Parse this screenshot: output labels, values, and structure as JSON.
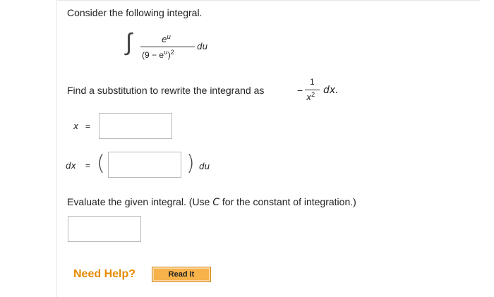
{
  "question": {
    "intro": "Consider the following integral.",
    "integral": {
      "integral_sign": "∫",
      "numerator": "e",
      "numerator_exp": "u",
      "denominator_open": "(9 − e",
      "denominator_exp": "u",
      "denominator_close": ")",
      "denominator_power": "2",
      "differential": "du"
    },
    "substitution_prompt": "Find a substitution to rewrite the integrand as",
    "target_minus": "−",
    "target_numerator": "1",
    "target_den_var": "x",
    "target_den_power": "2",
    "target_differential": "dx."
  },
  "x_field": {
    "label": "x",
    "equals": "=",
    "value": ""
  },
  "dx_field": {
    "label": "dx",
    "equals": "=",
    "open_paren": "(",
    "close_paren": ")",
    "value": "",
    "differential": "du"
  },
  "evaluate": {
    "prompt_before": "Evaluate the given integral. (Use ",
    "prompt_c": "C",
    "prompt_after": " for the constant of integration.)",
    "answer_value": ""
  },
  "help": {
    "label": "Need Help?",
    "read_it_label": "Read It"
  }
}
